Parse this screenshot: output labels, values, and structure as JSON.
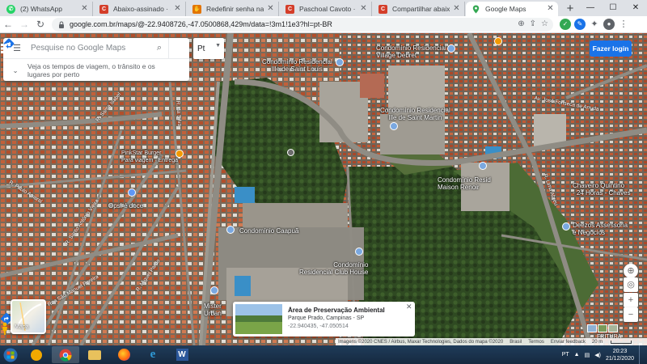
{
  "browser": {
    "tabs": [
      {
        "title": "(2) WhatsApp",
        "favicon": "whatsapp-icon",
        "color": "#25d366",
        "active": false
      },
      {
        "title": "Abaixo-assinado · Secret",
        "favicon": "change-org-icon",
        "color": "#d43e2a",
        "active": false
      },
      {
        "title": "Redefinir senha na Chan",
        "favicon": "handshake-icon",
        "color": "#e37400",
        "active": false
      },
      {
        "title": "Paschoal Cavoto · Chan",
        "favicon": "change-org-icon",
        "color": "#d43e2a",
        "active": false
      },
      {
        "title": "Compartilhar abaixo-ass",
        "favicon": "change-org-icon",
        "color": "#d43e2a",
        "active": false
      },
      {
        "title": "Google Maps",
        "favicon": "maps-pin-icon",
        "color": "#34a853",
        "active": true
      }
    ],
    "new_tab": "+",
    "window_controls": [
      "—",
      "☐",
      "✕"
    ],
    "url": "google.com.br/maps/@-22.9408726,-47.0500868,429m/data=!3m1!1e3?hl=pt-BR"
  },
  "maps": {
    "search": {
      "placeholder": "Pesquise no Google Maps",
      "travel_text": "Veja os tempos de viagem, o trânsito e os lugares por perto"
    },
    "language": "Pt",
    "login_button": "Fazer login",
    "labels": {
      "condo_ile": "Condomínio Residencial\nIlle de Saint Louis",
      "condo_debret": "Condomínio Residencial\nVillage Debret",
      "condo_martin": "Condomínio Residencial\nIlle de Saint Martin",
      "condo_maison": "Condomínio Resid\nMaison Renoir",
      "condo_caapua": "Condomínio Caapuã",
      "condo_club": "Condomínio\nResidencial Club House",
      "pinkstar": "PinkStar Burger\nPara viagem · Entrega",
      "ops": "Ops! é doce",
      "chaveiro": "Chaveiro Quintino\n- 24 Horas - Chaves",
      "deezos": "Deezos Assessoria\ne Negócios",
      "mister": "Mister\nUrban"
    },
    "streets": {
      "jose": "Av. José Fonseca de Arruda",
      "isabel": "R. Santa Isabel",
      "amaral": "R. Paulo Amaral",
      "antonio": "R. Santo Antônio Vieira",
      "manuel": "Rua São Manuel Pereira",
      "miguel": "R. Miguel Pardo",
      "lima": "R. Lima Abreu",
      "silva": "R. da Silva"
    },
    "info_card": {
      "title": "Área de Preservação Ambiental d...",
      "subtitle": "Parque Prado, Campinas - SP",
      "coords": "-22.940435, -47.050514"
    },
    "layer_label": "Mapa",
    "footer": {
      "attribution": "Imagens ©2020 CNES / Airbus, Maxar Technologies, Dados do mapa ©2020",
      "brasil": "Brasil",
      "termos": "Termos",
      "feedback": "Enviar feedback",
      "scale": "20 m"
    },
    "pegman_text": "FRITURA",
    "controls": {
      "zoom_in": "+",
      "zoom_out": "−"
    }
  },
  "taskbar": {
    "lang": "PT",
    "time": "20:23",
    "date": "21/12/2020"
  },
  "colors": {
    "accent": "#1a73e8",
    "forest": "#2f4a22",
    "roof": "#b5532d",
    "road": "#8f8c84"
  }
}
